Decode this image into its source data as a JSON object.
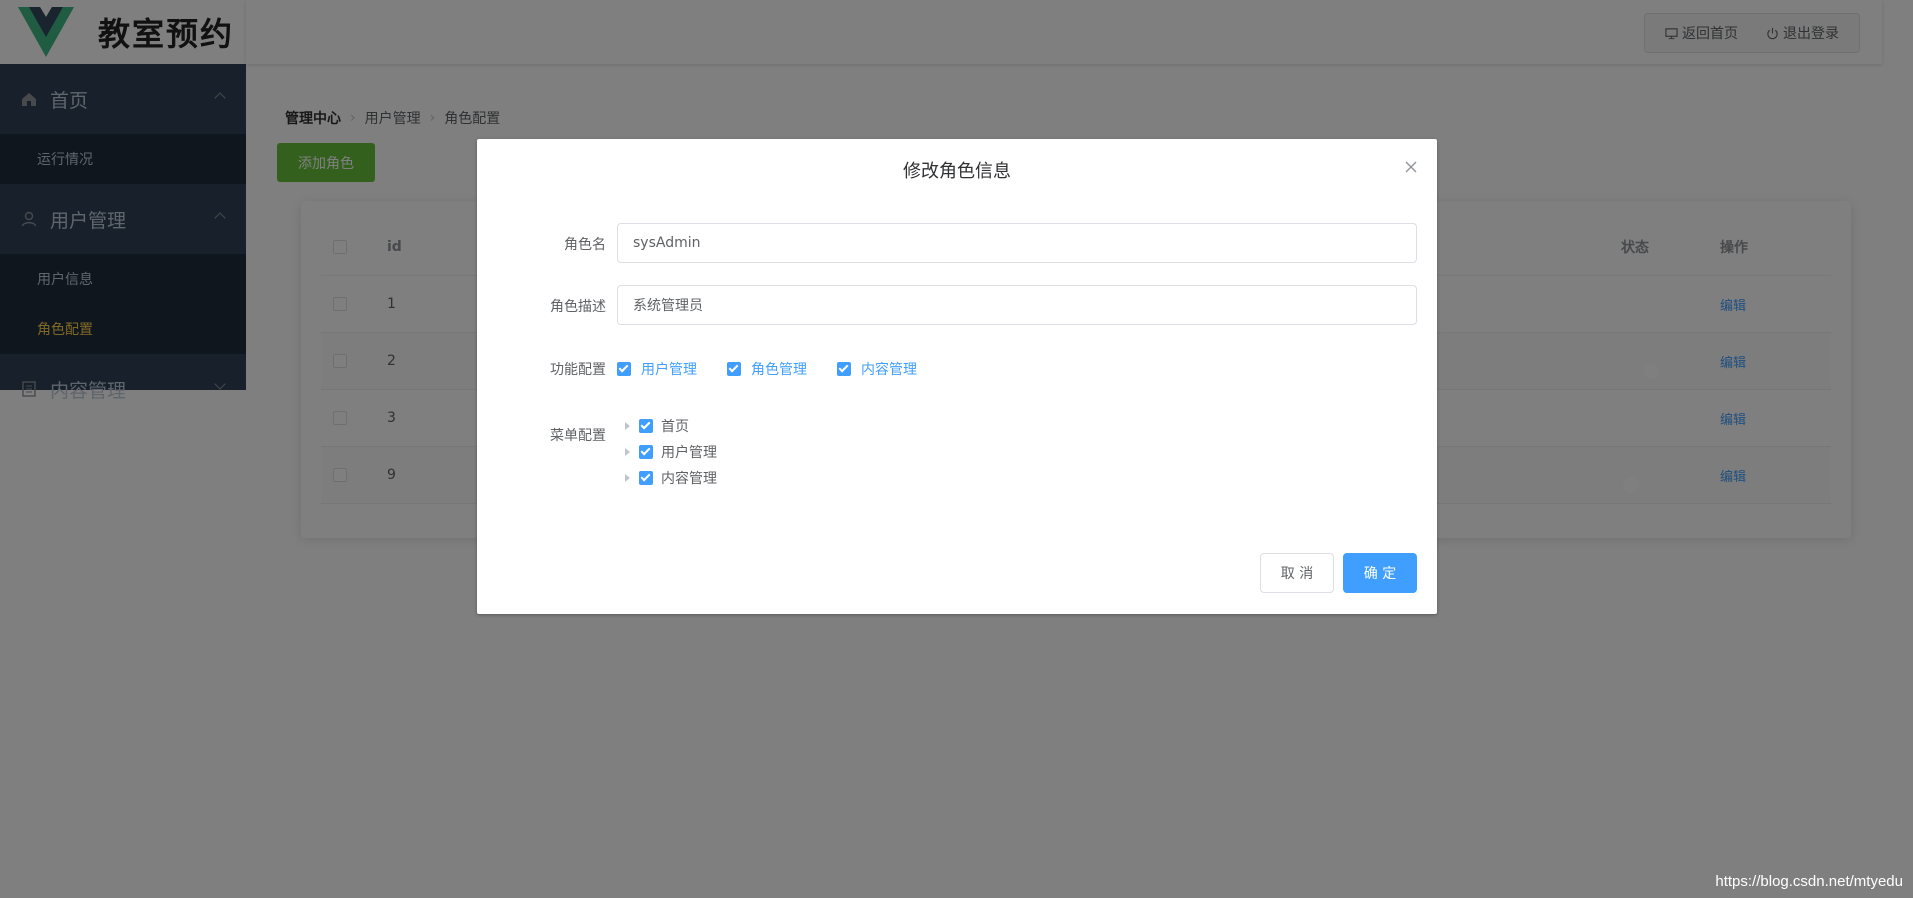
{
  "app": {
    "logo_text": "教室预约"
  },
  "header": {
    "home_label": "返回首页",
    "logout_label": "退出登录"
  },
  "sidebar": {
    "groups": [
      {
        "label": "首页",
        "icon": "home-icon",
        "items": [
          {
            "label": "运行情况"
          }
        ]
      },
      {
        "label": "用户管理",
        "icon": "user-icon",
        "items": [
          {
            "label": "用户信息"
          },
          {
            "label": "角色配置",
            "active": true
          }
        ]
      },
      {
        "label": "内容管理",
        "icon": "document-icon",
        "items": []
      }
    ]
  },
  "breadcrumb": [
    "管理中心",
    "用户管理",
    "角色配置"
  ],
  "toolbar": {
    "add_role_label": "添加角色"
  },
  "table": {
    "columns": {
      "id": "id",
      "status": "状态",
      "operation": "操作"
    },
    "rows": [
      {
        "id": "1",
        "status": "on",
        "action": "编辑"
      },
      {
        "id": "2",
        "status": "on",
        "action": "编辑"
      },
      {
        "id": "3",
        "status": "on",
        "action": "编辑"
      },
      {
        "id": "9",
        "status": "off",
        "action": "编辑"
      }
    ]
  },
  "dialog": {
    "title": "修改角色信息",
    "role_name_label": "角色名",
    "role_name_value": "sysAdmin",
    "role_desc_label": "角色描述",
    "role_desc_value": "系统管理员",
    "func_label": "功能配置",
    "funcs": [
      "用户管理",
      "角色管理",
      "内容管理"
    ],
    "menu_label": "菜单配置",
    "menus": [
      "首页",
      "用户管理",
      "内容管理"
    ],
    "cancel_label": "取 消",
    "ok_label": "确 定"
  },
  "watermark": "https://blog.csdn.net/mtyedu",
  "colors": {
    "primary": "#409eff",
    "success": "#67c23a",
    "sidebar": "#304156",
    "switch_on": "#13ce66",
    "switch_off": "#ff4949"
  }
}
